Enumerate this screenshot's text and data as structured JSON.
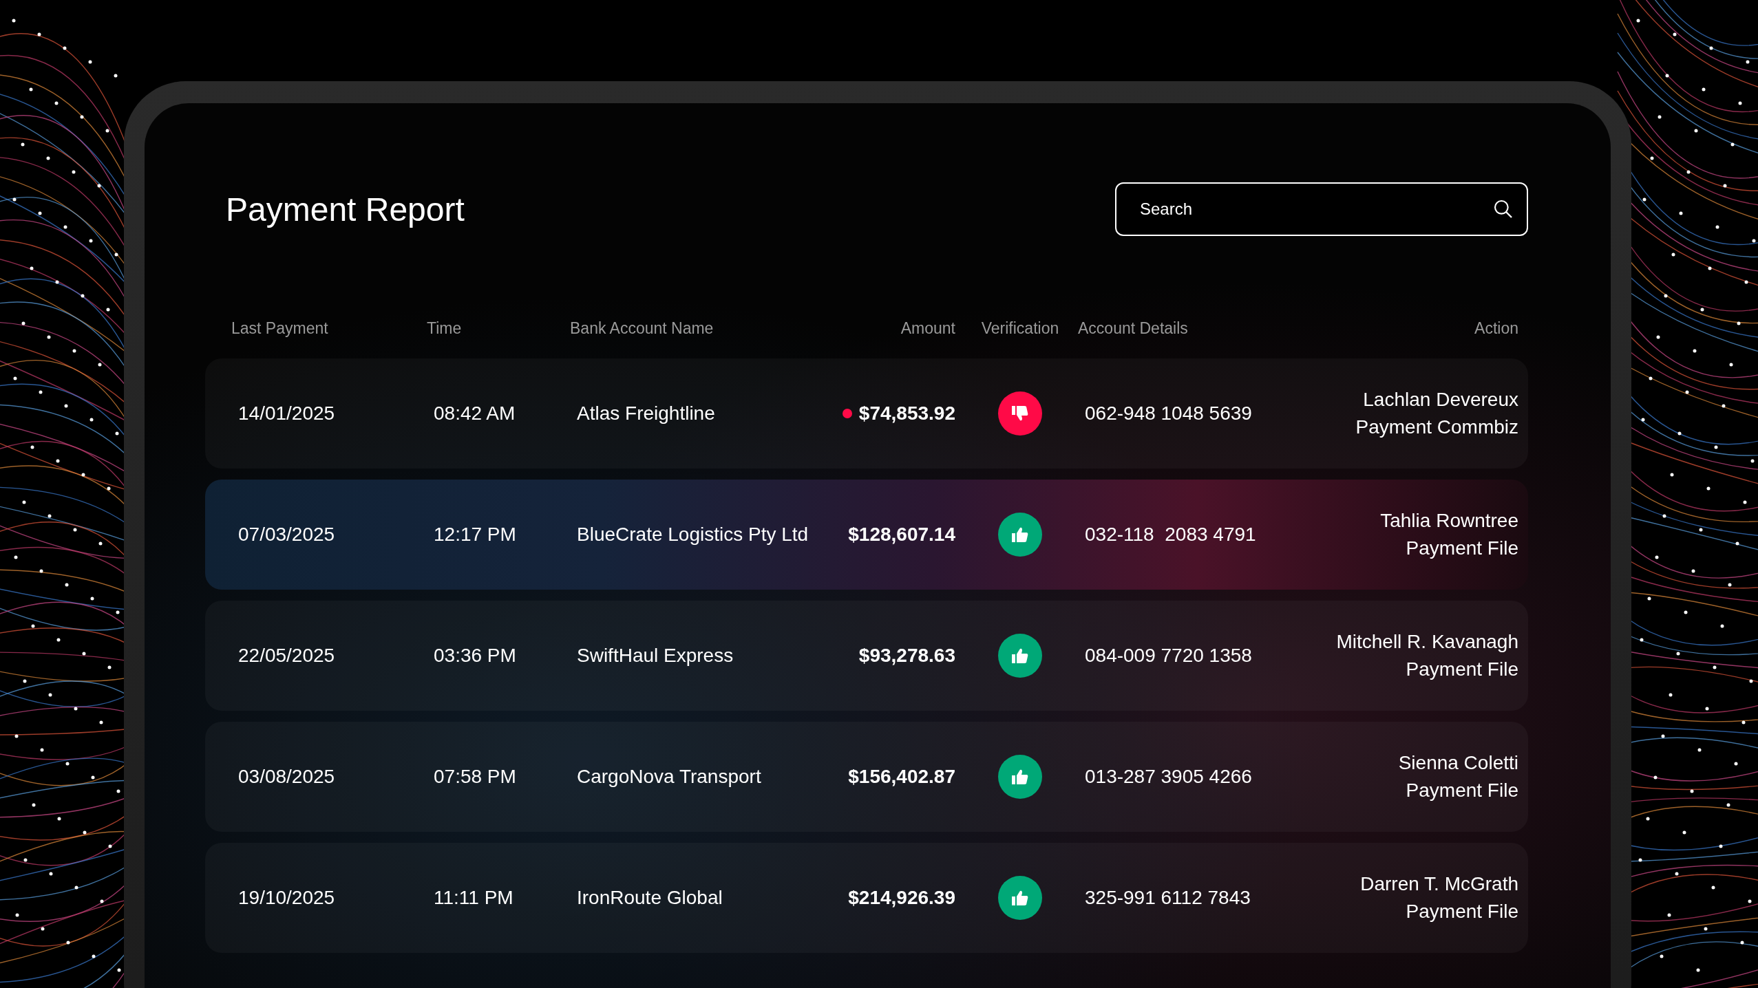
{
  "title": "Payment Report",
  "search": {
    "placeholder": "Search"
  },
  "columns": [
    "Last Payment",
    "Time",
    "Bank Account Name",
    "Amount",
    "Verification",
    "Account Details",
    "Action"
  ],
  "rows": [
    {
      "date": "14/01/2025",
      "time": "08:42 AM",
      "name": "Atlas Freightline",
      "amount": "$74,853.92",
      "flagged": true,
      "verified": false,
      "highlighted": false,
      "account": "062-948 1048 5639",
      "action_name": "Lachlan Devereux",
      "action_file": "Payment Commbiz"
    },
    {
      "date": "07/03/2025",
      "time": "12:17 PM",
      "name": "BlueCrate Logistics Pty Ltd",
      "amount": "$128,607.14",
      "flagged": false,
      "verified": true,
      "highlighted": true,
      "account": "032-118  2083 4791",
      "action_name": "Tahlia Rowntree",
      "action_file": "Payment File"
    },
    {
      "date": "22/05/2025",
      "time": "03:36 PM",
      "name": "SwiftHaul Express",
      "amount": "$93,278.63",
      "flagged": false,
      "verified": true,
      "highlighted": false,
      "account": "084-009 7720 1358",
      "action_name": "Mitchell R. Kavanagh",
      "action_file": "Payment File"
    },
    {
      "date": "03/08/2025",
      "time": "07:58 PM",
      "name": "CargoNova Transport",
      "amount": "$156,402.87",
      "flagged": false,
      "verified": true,
      "highlighted": false,
      "account": "013-287 3905 4266",
      "action_name": "Sienna Coletti",
      "action_file": "Payment File"
    },
    {
      "date": "19/10/2025",
      "time": "11:11 PM",
      "name": "IronRoute Global",
      "amount": "$214,926.39",
      "flagged": false,
      "verified": true,
      "highlighted": false,
      "account": "325-991 6112 7843",
      "action_name": "Darren T. McGrath",
      "action_file": "Payment File"
    }
  ]
}
